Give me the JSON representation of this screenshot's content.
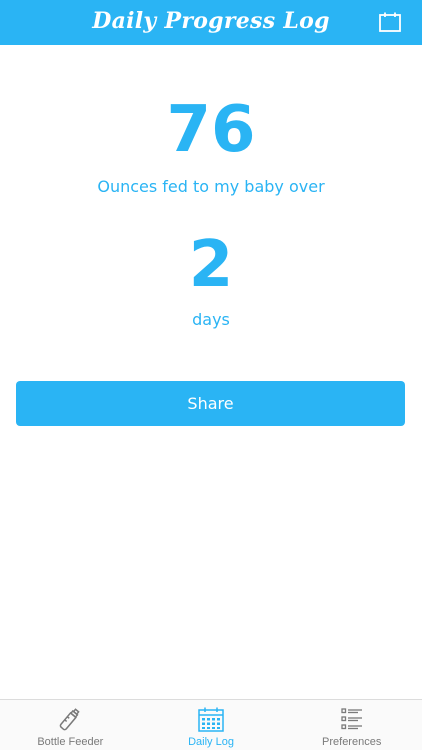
{
  "header": {
    "title": "Daily Progress Log",
    "calendar_icon": "calendar-icon"
  },
  "main": {
    "ounces_value": "76",
    "ounces_label": "Ounces fed to my baby over",
    "days_value": "2",
    "days_label": "days",
    "share_label": "Share"
  },
  "tabbar": {
    "tabs": [
      {
        "label": "Bottle Feeder",
        "icon": "baby-bottle-icon",
        "active": false
      },
      {
        "label": "Daily Log",
        "icon": "calendar-grid-icon",
        "active": true
      },
      {
        "label": "Preferences",
        "icon": "list-icon",
        "active": false
      }
    ]
  },
  "colors": {
    "accent": "#2ab4f4",
    "inactive": "#7a7a7a"
  }
}
